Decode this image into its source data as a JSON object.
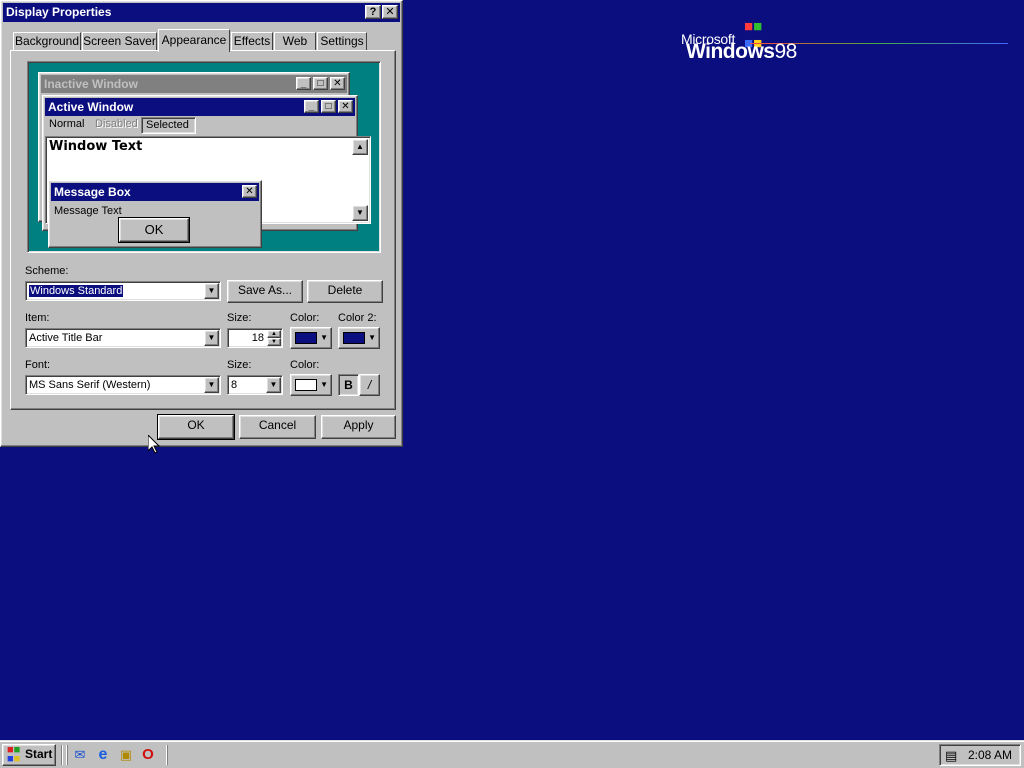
{
  "desktop": {
    "logo_ms": "Microsoft",
    "logo_windows": "Windows",
    "logo_version": "98",
    "background_color": "#0b0e7f"
  },
  "dialog": {
    "title": "Display Properties",
    "help_btn": "?",
    "close_btn": "✕",
    "tabs": [
      {
        "label": "Background"
      },
      {
        "label": "Screen Saver"
      },
      {
        "label": "Appearance"
      },
      {
        "label": "Effects"
      },
      {
        "label": "Web"
      },
      {
        "label": "Settings"
      }
    ],
    "active_tab": "Appearance",
    "preview": {
      "inactive_title": "Inactive Window",
      "active_title": "Active Window",
      "menu_normal": "Normal",
      "menu_disabled": "Disabled",
      "menu_selected": "Selected",
      "window_text": "Window Text",
      "msgbox_title": "Message Box",
      "msgbox_text": "Message Text",
      "msgbox_ok": "OK",
      "desktop_color": "#008080"
    },
    "scheme": {
      "label": "Scheme:",
      "value": "Windows Standard",
      "save_as": "Save As...",
      "delete": "Delete"
    },
    "item": {
      "label": "Item:",
      "value": "Active Title Bar",
      "size_label": "Size:",
      "size_value": "18",
      "color_label": "Color:",
      "color2_label": "Color 2:",
      "color_value": "#0b0e7f",
      "color2_value": "#0b0e7f"
    },
    "font": {
      "label": "Font:",
      "value": "MS Sans Serif (Western)",
      "size_label": "Size:",
      "size_value": "8",
      "color_label": "Color:",
      "color_value": "#ffffff",
      "bold": "B",
      "italic": "/"
    },
    "buttons": {
      "ok": "OK",
      "cancel": "Cancel",
      "apply": "Apply"
    }
  },
  "taskbar": {
    "start_label": "Start",
    "quicklaunch": [
      "outlook-express-icon",
      "internet-explorer-icon",
      "show-desktop-icon",
      "opera-icon"
    ],
    "clock": "2:08 AM"
  }
}
